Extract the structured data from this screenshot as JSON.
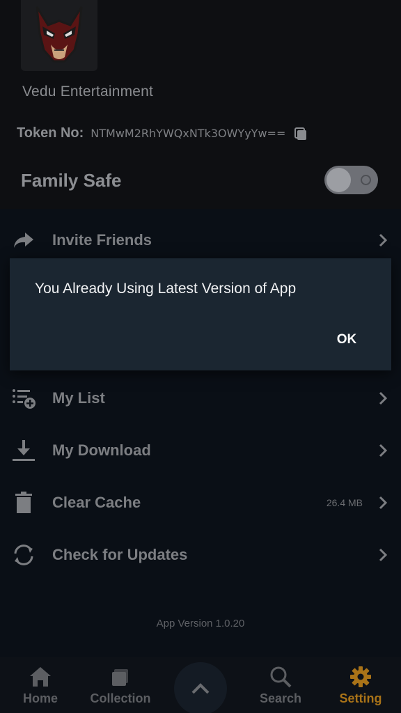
{
  "profile": {
    "company": "Vedu Entertainment",
    "token_label": "Token No:",
    "token_value": "NTMwM2RhYWQxNTk3OWYyYw==",
    "family_safe_label": "Family Safe",
    "family_safe_enabled": false
  },
  "menu": {
    "items": [
      {
        "label": "Invite Friends",
        "icon": "share-arrow-icon"
      },
      {
        "label": "My List",
        "icon": "playlist-add-icon"
      },
      {
        "label": "My Download",
        "icon": "download-icon"
      },
      {
        "label": "Clear Cache",
        "icon": "trash-icon",
        "size": "26.4 MB"
      },
      {
        "label": "Check for Updates",
        "icon": "refresh-icon"
      }
    ]
  },
  "app_version": "App Version 1.0.20",
  "bottom_nav": {
    "items": [
      {
        "label": "Home",
        "icon": "home-icon",
        "active": false
      },
      {
        "label": "Collection",
        "icon": "collection-icon",
        "active": false
      },
      {
        "label": "Search",
        "icon": "search-icon",
        "active": false
      },
      {
        "label": "Setting",
        "icon": "gear-icon",
        "active": true
      }
    ],
    "center_icon": "chevron-up-icon"
  },
  "dialog": {
    "message": "You Already Using Latest Version of App",
    "ok_label": "OK"
  },
  "colors": {
    "background": "#0a0f16",
    "dialog": "#1b2631",
    "active_tab": "#a97318"
  }
}
